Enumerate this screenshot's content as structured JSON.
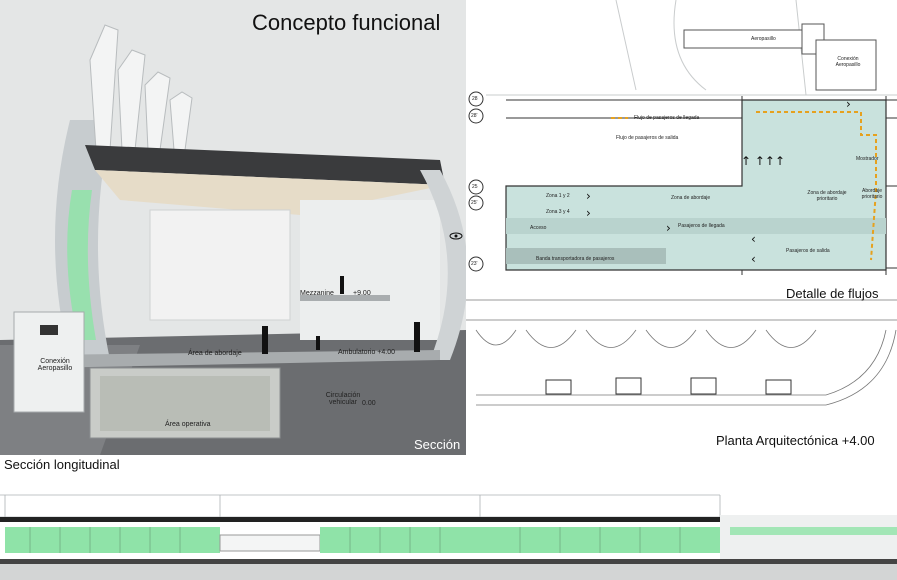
{
  "section": {
    "title": "Concepto funcional",
    "corner_label": "Sección",
    "labels": {
      "mezzanine": "Mezzanine",
      "level_mezzanine": "+9.00",
      "boarding_area": "Área de abordaje",
      "ambulatory": "Ambulatorio +4.00",
      "airbridge_connection": "Conexión Aeropasillo",
      "vehicular_circulation": "Circulación vehicular",
      "level_ground": "0.00",
      "operative_area": "Área operativa"
    }
  },
  "flows": {
    "title": "Detalle de flujos",
    "legend": {
      "arrival": "Flujo de pasajeros de llegada",
      "departure": "Flujo de pasajeros de salida"
    },
    "axes": [
      "28",
      "28'",
      "25",
      "25'",
      "23'"
    ],
    "labels": {
      "airbridge": "Aeropasillo",
      "airbridge_connection": "Conexión Aeropasillo",
      "zone_1_2": "Zona 1 y 2",
      "zone_3_4": "Zona 3 y 4",
      "boarding_zone": "Zona de abordaje",
      "priority_zone": "Zona de abordaje prioritario",
      "priority_boarding": "Abordaje prioritario",
      "counter": "Mostrador",
      "arriving_passengers": "Pasajeros de llegada",
      "departing_passengers": "Pasajeros de salida",
      "transport_band": "Banda transportadora de pasajeros",
      "access": "Acceso"
    }
  },
  "plan": {
    "title": "Planta Arquitectónica +4.00"
  },
  "longitudinal": {
    "title": "Sección longitudinal"
  },
  "colors": {
    "glass_green": "#8fe3a8",
    "flow_zone": "#c9e2dd",
    "roof": "#e6dcc8",
    "arrival_flow": "#e6a11e"
  }
}
